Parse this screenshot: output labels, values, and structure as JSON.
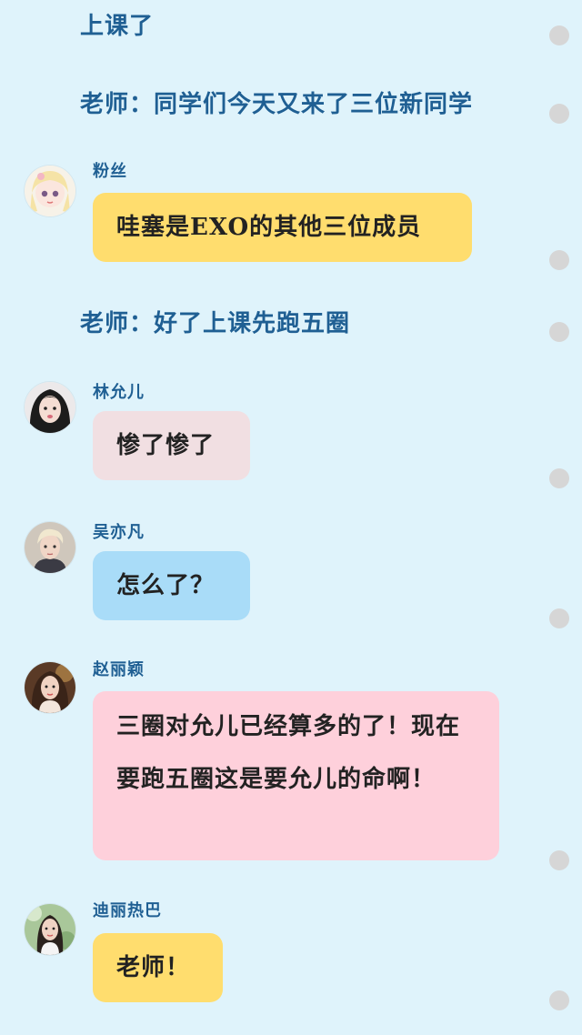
{
  "narration": [
    "上课了",
    "老师：同学们今天又来了三位新同学",
    "老师：好了上课先跑五圈"
  ],
  "messages": [
    {
      "sender": "粉丝",
      "text": "哇塞是EXO的其他三位成员",
      "bubble_color": "#ffdd6e",
      "avatar": "anime-girl-avatar"
    },
    {
      "sender": "林允儿",
      "text": "惨了惨了",
      "bubble_color": "#f1dfe2",
      "avatar": "woman-avatar"
    },
    {
      "sender": "吴亦凡",
      "text": "怎么了？",
      "bubble_color": "#a9dcf8",
      "avatar": "man-avatar"
    },
    {
      "sender": "赵丽颖",
      "text": "三圈对允儿已经算多的了！现在要跑五圈这是要允儿的命啊！",
      "bubble_color": "#fed0db",
      "avatar": "woman-avatar"
    },
    {
      "sender": "迪丽热巴",
      "text": "老师！",
      "bubble_color": "#ffdd6e",
      "avatar": "woman-avatar"
    }
  ],
  "colors": {
    "background": "#dff3fb",
    "narration_text": "#1f5f93",
    "sender_text": "#1f5f93",
    "scroll_dot": "#d6d6d6"
  }
}
